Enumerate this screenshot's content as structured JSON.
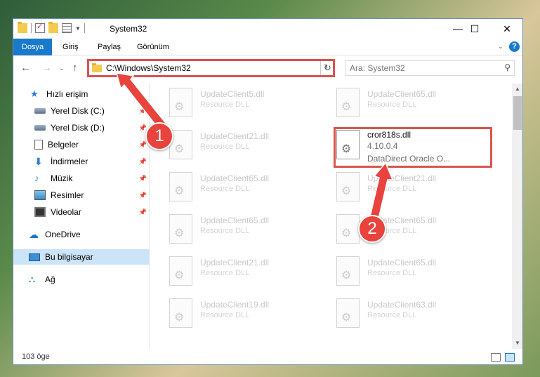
{
  "window": {
    "title": "System32"
  },
  "ribbon": {
    "tabs": [
      {
        "label": "Dosya",
        "active": true
      },
      {
        "label": "Giriş",
        "active": false
      },
      {
        "label": "Paylaş",
        "active": false
      },
      {
        "label": "Görünüm",
        "active": false
      }
    ]
  },
  "address": {
    "path": "C:\\Windows\\System32"
  },
  "search": {
    "placeholder": "Ara: System32"
  },
  "sidebar": {
    "items": [
      {
        "label": "Hızlı erişim",
        "icon": "star-icon",
        "pinned": false
      },
      {
        "label": "Yerel Disk (C:)",
        "icon": "drive-icon",
        "pinned": true
      },
      {
        "label": "Yerel Disk (D:)",
        "icon": "drive-icon",
        "pinned": true
      },
      {
        "label": "Belgeler",
        "icon": "document-icon",
        "pinned": true
      },
      {
        "label": "İndirmeler",
        "icon": "download-icon",
        "pinned": true
      },
      {
        "label": "Müzik",
        "icon": "music-icon",
        "pinned": true
      },
      {
        "label": "Resimler",
        "icon": "picture-icon",
        "pinned": true
      },
      {
        "label": "Videolar",
        "icon": "video-icon",
        "pinned": true
      },
      {
        "label": "OneDrive",
        "icon": "cloud-icon",
        "pinned": false
      },
      {
        "label": "Bu bilgisayar",
        "icon": "computer-icon",
        "pinned": false,
        "selected": true
      },
      {
        "label": "Ağ",
        "icon": "network-icon",
        "pinned": false
      }
    ]
  },
  "files": {
    "left": [
      {
        "name": "UpdateClient5.dll",
        "desc": "Resource DLL"
      },
      {
        "name": "UpdateClient21.dll",
        "desc": "Resource DLL"
      },
      {
        "name": "UpdateClient65.dll",
        "desc": "Resource DLL"
      },
      {
        "name": "UpdateClient65.dll",
        "desc": "Resource DLL"
      },
      {
        "name": "UpdateClient21.dll",
        "desc": "Resource DLL"
      },
      {
        "name": "UpdateClient19.dll",
        "desc": "Resource DLL"
      }
    ],
    "right": [
      {
        "name": "UpdateClient65.dll",
        "desc": "Resource DLL"
      },
      {
        "name": "UpdateClient21.dll",
        "desc": "Resource DLL"
      },
      {
        "name": "UpdateClient65.dll",
        "desc": "Resource DLL"
      },
      {
        "name": "UpdateClient65.dll",
        "desc": "Resource DLL"
      },
      {
        "name": "UpdateClient63.dll",
        "desc": "Resource DLL"
      }
    ],
    "highlighted": {
      "name": "cror818s.dll",
      "version": "4.10.0.4",
      "description": "DataDirect Oracle O..."
    }
  },
  "status": {
    "item_count": "103 öge"
  },
  "annotations": {
    "badge1": "1",
    "badge2": "2",
    "color": "#e8433d"
  }
}
